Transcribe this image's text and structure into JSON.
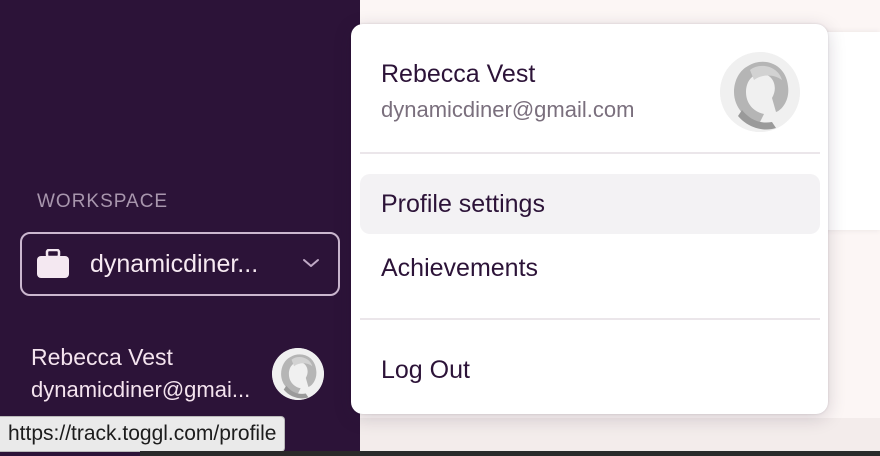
{
  "sidebar": {
    "workspace_heading": "WORKSPACE",
    "workspace_name": "dynamicdiner...",
    "user_name": "Rebecca Vest",
    "user_email": "dynamicdiner@gmai..."
  },
  "menu": {
    "user_name": "Rebecca Vest",
    "user_email": "dynamicdiner@gmail.com",
    "items": [
      {
        "label": "Profile settings"
      },
      {
        "label": "Achievements"
      },
      {
        "label": "Log Out"
      }
    ]
  },
  "status_bar": {
    "url": "https://track.toggl.com/profile"
  },
  "icons": {
    "workspace": "briefcase-icon",
    "dropdown": "chevron-down-icon",
    "avatar": "avatar-placeholder-icon"
  },
  "colors": {
    "sidebar_bg": "#2c1338",
    "accent_text": "#2c1338",
    "menu_bg": "#ffffff",
    "active_item_bg": "#f3f2f4"
  }
}
